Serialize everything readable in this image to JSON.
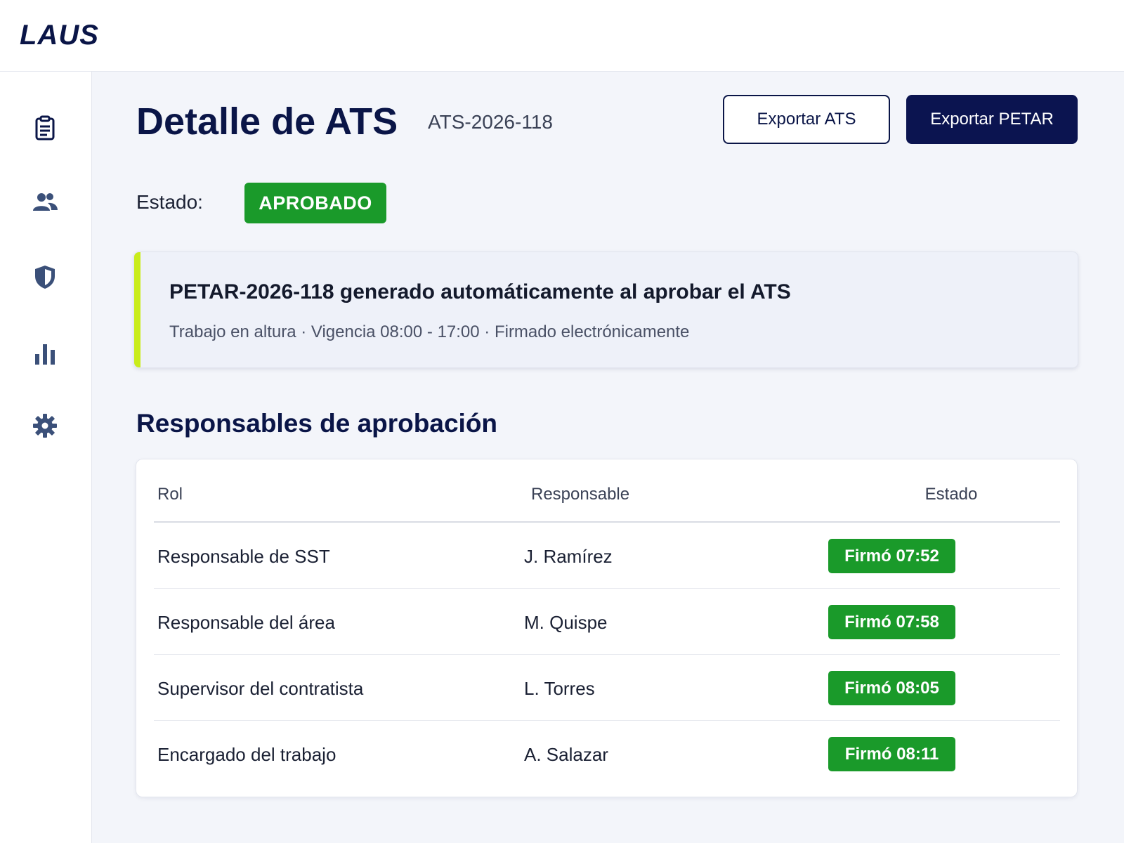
{
  "app": {
    "logo": "LAUS"
  },
  "sidebar": {
    "items": [
      {
        "icon": "clipboard-icon"
      },
      {
        "icon": "users-icon"
      },
      {
        "icon": "shield-icon"
      },
      {
        "icon": "bar-chart-icon"
      },
      {
        "icon": "gear-icon"
      }
    ]
  },
  "header": {
    "title": "Detalle de ATS",
    "code": "ATS-2026-118",
    "export_ats_label": "Exportar ATS",
    "export_petar_label": "Exportar PETAR"
  },
  "status": {
    "label": "Estado:",
    "value": "APROBADO",
    "color": "#1a9a2a"
  },
  "notice": {
    "title": "PETAR-2026-118 generado automáticamente al aprobar el ATS",
    "subtitle": "Trabajo en altura · Vigencia 08:00 - 17:00 · Firmado electrónicamente",
    "accent_color": "#c9ec1b"
  },
  "approvals": {
    "section_title": "Responsables de aprobación",
    "columns": [
      "Rol",
      "Responsable",
      "Estado"
    ],
    "rows": [
      {
        "rol": "Responsable de SST",
        "responsable": "J. Ramírez",
        "estado": "Firmó 07:52"
      },
      {
        "rol": "Responsable del área",
        "responsable": "M. Quispe",
        "estado": "Firmó 07:58"
      },
      {
        "rol": "Supervisor del contratista",
        "responsable": "L. Torres",
        "estado": "Firmó 08:05"
      },
      {
        "rol": "Encargado del trabajo",
        "responsable": "A. Salazar",
        "estado": "Firmó 08:11"
      }
    ]
  },
  "colors": {
    "brand_navy": "#0a1547",
    "success_green": "#1a9a2a"
  }
}
